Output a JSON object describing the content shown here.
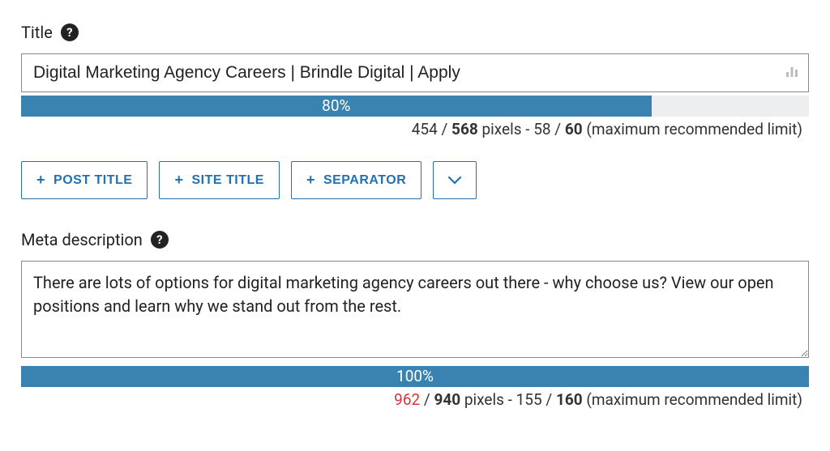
{
  "title_section": {
    "label": "Title",
    "value": "Digital Marketing Agency Careers | Brindle Digital | Apply",
    "progress_percent": "80%",
    "progress_width": 80,
    "px_used": "454",
    "px_limit": "568",
    "chars_used": "58",
    "chars_limit": "60",
    "limit_suffix_a": "pixels - ",
    "limit_suffix_b": "(maximum recommended limit)",
    "px_over_limit": false
  },
  "variable_chips": {
    "post_title": "POST TITLE",
    "site_title": "SITE TITLE",
    "separator": "SEPARATOR"
  },
  "meta_section": {
    "label": "Meta description",
    "value": "There are lots of options for digital marketing agency careers out there - why choose us? View our open positions and learn why we stand out from the rest.",
    "progress_percent": "100%",
    "progress_width": 100,
    "px_used": "962",
    "px_limit": "940",
    "chars_used": "155",
    "chars_limit": "160",
    "limit_suffix_a": "pixels - ",
    "limit_suffix_b": "(maximum recommended limit)",
    "px_over_limit": true
  }
}
